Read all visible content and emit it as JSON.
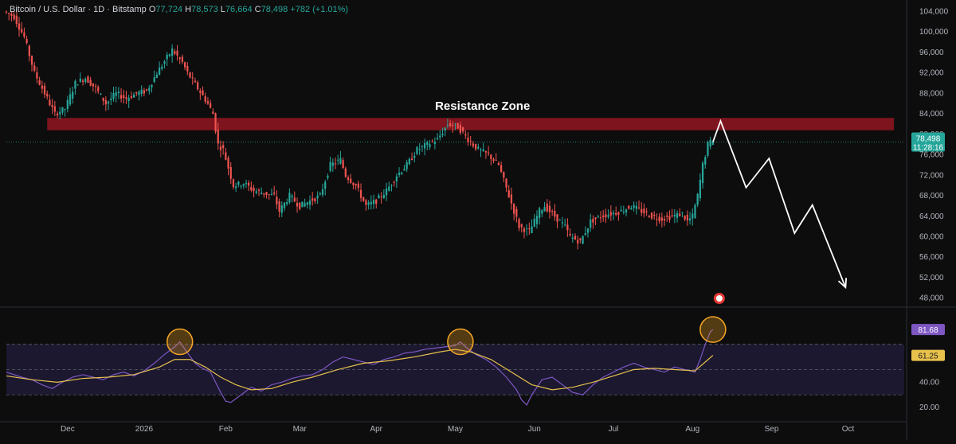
{
  "header": {
    "symbol": "Bitcoin / U.S. Dollar · 1D · Bitstamp",
    "open_label": "O",
    "open": "77,724",
    "high_label": "H",
    "high": "78,573",
    "low_label": "L",
    "low": "76,664",
    "close_label": "C",
    "close": "78,498",
    "change": "+782 (+1.01%)"
  },
  "colors": {
    "background": "#0d0d0d",
    "up": "#26a69a",
    "down": "#ef5350",
    "resistance": "#8b1520",
    "rsi_line": "#7e57c2",
    "rsi_ma": "#e8c14d",
    "rsi_band": "#1f1b36",
    "highlight_circle": "#f5a623",
    "price_tag": "#26a69a",
    "rsi_tag": "#7e57c2",
    "rsi_ma_tag": "#e8c14d",
    "projection": "#ffffff"
  },
  "annotation": {
    "resistance_label": "Resistance Zone"
  },
  "price_tag": {
    "price": "78,498",
    "countdown": "11:28:16"
  },
  "chart_data": {
    "type": "candlestick",
    "price_axis": {
      "ticks": [
        "104,000",
        "100,000",
        "96,000",
        "92,000",
        "88,000",
        "84,000",
        "80,000",
        "76,000",
        "72,000",
        "68,000",
        "64,000",
        "60,000",
        "56,000",
        "52,000",
        "48,000"
      ],
      "range": [
        46400,
        105000
      ]
    },
    "time_axis": {
      "labels": [
        "Dec",
        "2026",
        "Feb",
        "Mar",
        "Apr",
        "May",
        "Jun",
        "Jul",
        "Aug",
        "Sep",
        "Oct"
      ],
      "label_days": [
        24,
        54,
        86,
        115,
        145,
        176,
        207,
        238,
        269,
        300,
        330
      ],
      "day_range": [
        0,
        352
      ]
    },
    "price_path": [
      [
        0,
        104000
      ],
      [
        4,
        103000
      ],
      [
        8,
        99000
      ],
      [
        12,
        92000
      ],
      [
        16,
        88000
      ],
      [
        20,
        84000
      ],
      [
        24,
        85000
      ],
      [
        28,
        90000
      ],
      [
        32,
        91000
      ],
      [
        36,
        89000
      ],
      [
        40,
        86000
      ],
      [
        44,
        88000
      ],
      [
        48,
        87000
      ],
      [
        52,
        88000
      ],
      [
        56,
        88500
      ],
      [
        60,
        92000
      ],
      [
        64,
        95000
      ],
      [
        66,
        96500
      ],
      [
        70,
        94000
      ],
      [
        72,
        92000
      ],
      [
        76,
        89000
      ],
      [
        80,
        86000
      ],
      [
        82,
        84000
      ],
      [
        84,
        78000
      ],
      [
        86,
        77000
      ],
      [
        90,
        70000
      ],
      [
        94,
        70500
      ],
      [
        98,
        69000
      ],
      [
        102,
        68500
      ],
      [
        106,
        68000
      ],
      [
        108,
        65000
      ],
      [
        112,
        68000
      ],
      [
        116,
        66000
      ],
      [
        120,
        67000
      ],
      [
        124,
        68000
      ],
      [
        128,
        74000
      ],
      [
        132,
        75000
      ],
      [
        134,
        72000
      ],
      [
        138,
        70000
      ],
      [
        142,
        66000
      ],
      [
        146,
        67000
      ],
      [
        150,
        69000
      ],
      [
        154,
        72000
      ],
      [
        158,
        74000
      ],
      [
        162,
        77000
      ],
      [
        166,
        78000
      ],
      [
        170,
        79000
      ],
      [
        174,
        82000
      ],
      [
        178,
        81500
      ],
      [
        182,
        79000
      ],
      [
        186,
        77000
      ],
      [
        190,
        76000
      ],
      [
        194,
        74000
      ],
      [
        196,
        71000
      ],
      [
        198,
        68000
      ],
      [
        200,
        65000
      ],
      [
        202,
        62000
      ],
      [
        206,
        61000
      ],
      [
        210,
        65000
      ],
      [
        212,
        66000
      ],
      [
        216,
        64000
      ],
      [
        220,
        62000
      ],
      [
        222,
        60000
      ],
      [
        226,
        59000
      ],
      [
        230,
        63000
      ],
      [
        234,
        64000
      ],
      [
        238,
        64500
      ],
      [
        242,
        65000
      ],
      [
        246,
        66000
      ],
      [
        250,
        65000
      ],
      [
        254,
        64000
      ],
      [
        258,
        63500
      ],
      [
        262,
        64000
      ],
      [
        266,
        64500
      ],
      [
        268,
        63000
      ],
      [
        270,
        64000
      ],
      [
        272,
        68000
      ],
      [
        274,
        74000
      ],
      [
        276,
        78000
      ],
      [
        277,
        78498
      ]
    ],
    "resistance_zone": {
      "low": 80800,
      "high": 83200,
      "day_start": 16,
      "day_end": 348
    },
    "current_price": 78498,
    "projection": [
      [
        277,
        78498
      ],
      [
        280,
        82600
      ],
      [
        290,
        69600
      ],
      [
        299,
        75300
      ],
      [
        309,
        60700
      ],
      [
        316,
        66200
      ],
      [
        329,
        50100
      ]
    ],
    "projection_arrow_at": [
      329,
      50100
    ],
    "rsi": {
      "axis_ticks": [
        "40.00",
        "20.00"
      ],
      "range": [
        10,
        95
      ],
      "band": [
        30,
        70
      ],
      "mid": 50,
      "current": "81.68",
      "ma_current": "61.25",
      "path": [
        [
          0,
          48
        ],
        [
          6,
          44
        ],
        [
          10,
          42
        ],
        [
          14,
          38
        ],
        [
          18,
          35
        ],
        [
          22,
          40
        ],
        [
          26,
          44
        ],
        [
          30,
          46
        ],
        [
          34,
          44
        ],
        [
          38,
          42
        ],
        [
          42,
          46
        ],
        [
          46,
          48
        ],
        [
          50,
          45
        ],
        [
          54,
          49
        ],
        [
          58,
          55
        ],
        [
          62,
          62
        ],
        [
          66,
          68
        ],
        [
          68,
          72
        ],
        [
          70,
          66
        ],
        [
          74,
          55
        ],
        [
          76,
          52
        ],
        [
          80,
          48
        ],
        [
          82,
          40
        ],
        [
          84,
          32
        ],
        [
          86,
          25
        ],
        [
          88,
          24
        ],
        [
          92,
          30
        ],
        [
          96,
          36
        ],
        [
          100,
          33
        ],
        [
          104,
          38
        ],
        [
          108,
          40
        ],
        [
          112,
          43
        ],
        [
          116,
          45
        ],
        [
          120,
          46
        ],
        [
          124,
          50
        ],
        [
          128,
          56
        ],
        [
          132,
          60
        ],
        [
          136,
          58
        ],
        [
          140,
          56
        ],
        [
          144,
          54
        ],
        [
          148,
          58
        ],
        [
          152,
          60
        ],
        [
          156,
          63
        ],
        [
          160,
          64
        ],
        [
          164,
          66
        ],
        [
          168,
          67
        ],
        [
          172,
          68
        ],
        [
          176,
          69
        ],
        [
          178,
          72
        ],
        [
          180,
          68
        ],
        [
          184,
          62
        ],
        [
          188,
          58
        ],
        [
          192,
          52
        ],
        [
          196,
          44
        ],
        [
          200,
          34
        ],
        [
          202,
          26
        ],
        [
          204,
          22
        ],
        [
          206,
          30
        ],
        [
          210,
          42
        ],
        [
          214,
          44
        ],
        [
          218,
          38
        ],
        [
          222,
          32
        ],
        [
          226,
          30
        ],
        [
          230,
          38
        ],
        [
          234,
          44
        ],
        [
          238,
          48
        ],
        [
          242,
          52
        ],
        [
          246,
          55
        ],
        [
          250,
          52
        ],
        [
          254,
          50
        ],
        [
          258,
          48
        ],
        [
          262,
          52
        ],
        [
          266,
          50
        ],
        [
          270,
          48
        ],
        [
          272,
          58
        ],
        [
          274,
          70
        ],
        [
          276,
          80
        ],
        [
          277,
          81.68
        ]
      ],
      "ma_path": [
        [
          0,
          45
        ],
        [
          10,
          42
        ],
        [
          20,
          40
        ],
        [
          30,
          43
        ],
        [
          40,
          44
        ],
        [
          50,
          46
        ],
        [
          60,
          52
        ],
        [
          66,
          58
        ],
        [
          72,
          58
        ],
        [
          78,
          52
        ],
        [
          84,
          44
        ],
        [
          90,
          38
        ],
        [
          96,
          34
        ],
        [
          104,
          35
        ],
        [
          112,
          40
        ],
        [
          120,
          44
        ],
        [
          130,
          50
        ],
        [
          140,
          55
        ],
        [
          150,
          57
        ],
        [
          160,
          60
        ],
        [
          170,
          64
        ],
        [
          176,
          66
        ],
        [
          182,
          64
        ],
        [
          190,
          58
        ],
        [
          198,
          48
        ],
        [
          206,
          38
        ],
        [
          214,
          34
        ],
        [
          222,
          36
        ],
        [
          230,
          40
        ],
        [
          238,
          45
        ],
        [
          246,
          50
        ],
        [
          254,
          51
        ],
        [
          262,
          50
        ],
        [
          270,
          49
        ],
        [
          277,
          61.25
        ]
      ],
      "highlight_days": [
        68,
        178,
        277
      ]
    }
  }
}
